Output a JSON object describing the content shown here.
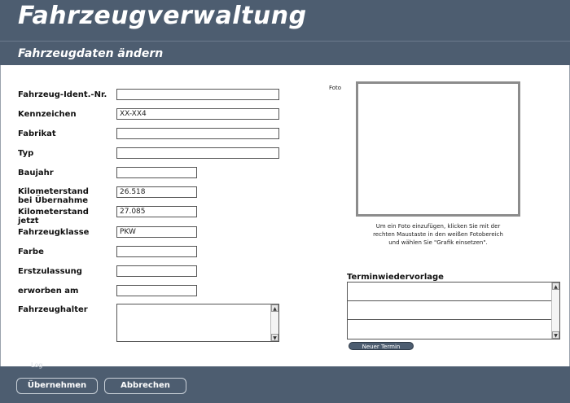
{
  "header": {
    "title": "Fahrzeugverwaltung",
    "subtitle": "Fahrzeugdaten ändern"
  },
  "form": {
    "fields": [
      {
        "label": "Fahrzeug-Ident.-Nr.",
        "value": ""
      },
      {
        "label": "Kennzeichen",
        "value": "XX-XX4"
      },
      {
        "label": "Fabrikat",
        "value": ""
      },
      {
        "label": "Typ",
        "value": ""
      },
      {
        "label": "Baujahr",
        "value": ""
      },
      {
        "label": "Kilometerstand bei Übernahme",
        "label_line1": "Kilometerstand",
        "label_line2": "bei Übernahme",
        "value": "26.518"
      },
      {
        "label": "Kilometerstand jetzt",
        "label_line1": "Kilometerstand",
        "label_line2": "jetzt",
        "value": "27.085"
      },
      {
        "label": "Fahrzeugklasse",
        "value": "PKW"
      },
      {
        "label": "Farbe",
        "value": ""
      },
      {
        "label": "Erstzulassung",
        "value": ""
      },
      {
        "label": "erworben am",
        "value": ""
      },
      {
        "label": "Fahrzeughalter",
        "value": ""
      }
    ]
  },
  "photo": {
    "label": "Foto",
    "hint_line1": "Um ein Foto einzufügen, klicken Sie mit der",
    "hint_line2": "rechten Maustaste in den weißen Fotobereich",
    "hint_line3": "und wählen Sie  \"Grafik einsetzen\"."
  },
  "termin": {
    "title": "Terminwiedervorlage",
    "rows": [
      "",
      "",
      ""
    ],
    "new_button": "Neuer Termin"
  },
  "footer": {
    "ghost_text": "Log",
    "apply_button": "Übernehmen",
    "cancel_button": "Abbrechen"
  },
  "icons": {
    "scroll_up": "scroll-up-arrow-icon",
    "scroll_down": "scroll-down-arrow-icon"
  },
  "colors": {
    "header_bg": "#4d5d70",
    "photo_border": "#8c8c8c"
  }
}
